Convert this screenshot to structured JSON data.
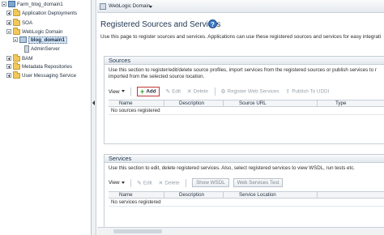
{
  "nav": {
    "farm": "Farm_blog_domain1",
    "items": [
      "Application Deployments",
      "SOA",
      "WebLogic Domain",
      "blog_domain1",
      "AdminServer",
      "BAM",
      "Metadata Repositories",
      "User Messaging Service"
    ]
  },
  "context": {
    "domain_menu": "WebLogic Domain"
  },
  "page": {
    "title": "Registered Sources and Services",
    "help": "?",
    "intro": "Use this page to register sources and services. Applications can use these registered sources and services for easy integrati"
  },
  "sources": {
    "heading": "Sources",
    "description_line1": "Use this section to register/edit/delete source profiles, import services from the registered sources or publish services to r",
    "description_line2": "imported from the selected source location.",
    "toolbar": {
      "view": "View",
      "add": "Add",
      "edit": "Edit",
      "delete": "Delete",
      "register": "Register Web Services",
      "publish": "Publish To UDDI"
    },
    "columns": [
      "Name",
      "Description",
      "Source URL",
      "Type"
    ],
    "empty": "No sources registered"
  },
  "services": {
    "heading": "Services",
    "description": "Use this section to edit, delete registered services. Also, select registered services to view WSDL, run tests etc.",
    "toolbar": {
      "view": "View",
      "edit": "Edit",
      "delete": "Delete",
      "show_wsdl": "Show WSDL",
      "ws_test": "Web Services Test"
    },
    "columns": [
      "Name",
      "Description",
      "Service Location"
    ],
    "empty": "No services registered"
  }
}
